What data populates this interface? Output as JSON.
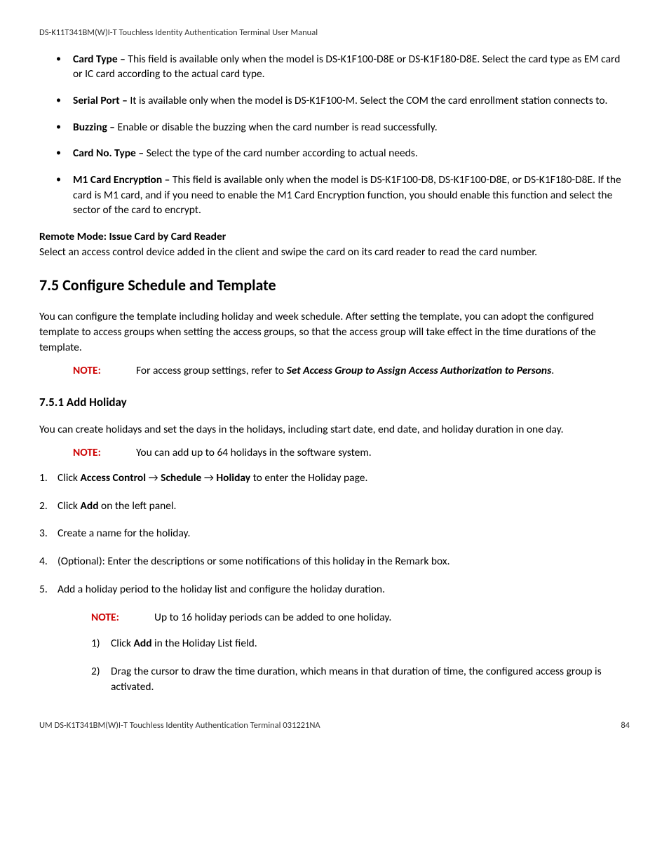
{
  "header": "DS-K11T341BM(W)I-T Touchless Identity Authentication Terminal User Manual",
  "bullets": [
    {
      "label": "Card Type – ",
      "text": "This field is available only when the model is DS-K1F100-D8E or DS-K1F180-D8E. Select the card type as EM card or IC card according to the actual card type."
    },
    {
      "label": "Serial Port – ",
      "text": "It is available only when the model is DS-K1F100-M. Select the COM the card enrollment station connects to."
    },
    {
      "label": "Buzzing – ",
      "text": "Enable or disable the buzzing when the card number is read successfully."
    },
    {
      "label": "Card No. Type – ",
      "text": "Select the type of the card number according to actual needs."
    },
    {
      "label": "M1 Card Encryption – ",
      "text": "This field is available only when the model is DS-K1F100-D8, DS-K1F100-D8E, or DS-K1F180-D8E. If the card is M1 card, and if you need to enable the M1 Card Encryption function, you should enable this function and select the sector of the card to encrypt."
    }
  ],
  "remote_mode_title": "Remote Mode: Issue Card by Card Reader",
  "remote_mode_text": "Select an access control device added in the client and swipe the card on its card reader to read the card number.",
  "section_heading": "7.5 Configure Schedule and Template",
  "section_intro": "You can configure the template including holiday and week schedule. After setting the template, you can adopt the configured template to access groups when setting the access groups, so that the access group will take effect in the time durations of the template.",
  "note1_label": "NOTE:",
  "note1_pre": "For access group settings, refer to ",
  "note1_ref": "Set Access Group to Assign Access Authorization to Persons",
  "note1_post": ".",
  "subsection_heading": "7.5.1 Add Holiday",
  "subsection_intro": "You can create holidays and set the days in the holidays, including start date, end date, and holiday duration in one day.",
  "note2_label": "NOTE:",
  "note2_text": "You can add up to 64 holidays in the software system.",
  "steps": {
    "s1_pre": "Click ",
    "s1_b1": "Access Control",
    "s1_arrow1": " → ",
    "s1_b2": "Schedule",
    "s1_arrow2": " → ",
    "s1_b3": "Holiday",
    "s1_post": " to enter the Holiday page.",
    "s2_pre": "Click ",
    "s2_b": "Add",
    "s2_post": " on the left panel.",
    "s3": "Create a name for the holiday.",
    "s4": "(Optional): Enter the descriptions or some notifications of this holiday in the Remark box.",
    "s5": "Add a holiday period to the holiday list and configure the holiday duration."
  },
  "note3_label": "NOTE:",
  "note3_text": "Up to 16 holiday periods can be added to one holiday.",
  "substeps": {
    "a_pre": "Click ",
    "a_b": "Add",
    "a_post": " in the Holiday List field.",
    "b": "Drag the cursor to draw the time duration, which means in that duration of time, the configured access group is activated."
  },
  "footer_left": "UM DS-K1T341BM(W)I-T Touchless Identity Authentication Terminal 031221NA",
  "footer_right": "84"
}
